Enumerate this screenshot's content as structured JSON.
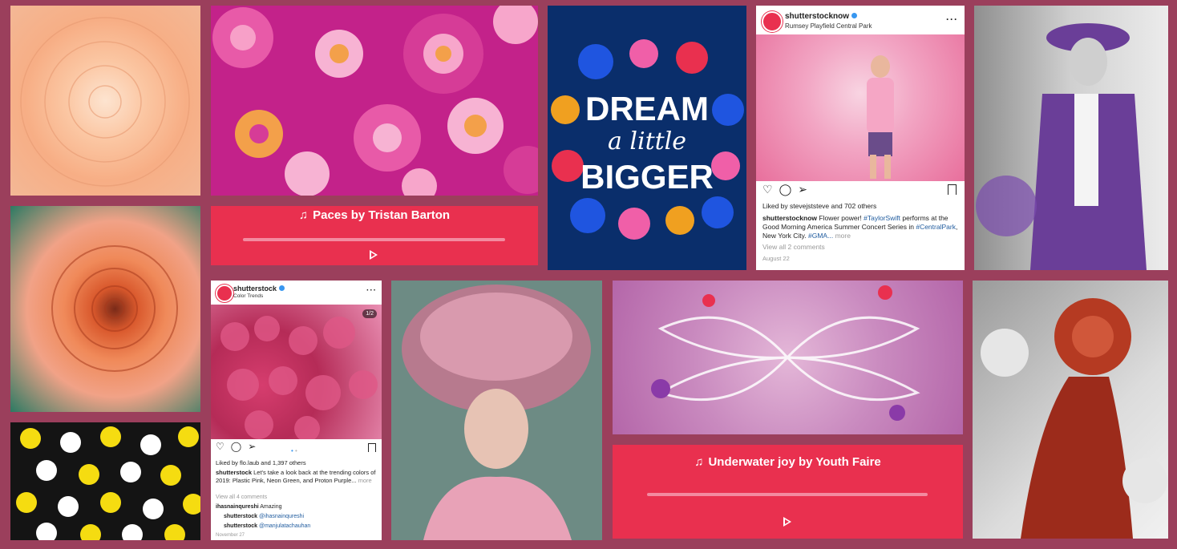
{
  "colors": {
    "background": "#9b3f5c",
    "player": "#e9304f",
    "track": "#f38aa0"
  },
  "players": [
    {
      "title": "Paces by Tristan Barton",
      "icon": "music-note-icon",
      "play_icon": "play-icon"
    },
    {
      "title": "Underwater joy by Youth Faire",
      "icon": "music-note-icon",
      "play_icon": "play-icon"
    }
  ],
  "dream_card": {
    "line1": "DREAM",
    "line2": "a little",
    "line3": "BIGGER"
  },
  "post_taylor": {
    "username": "shutterstocknow",
    "location": "Rumsey Playfield Central Park",
    "liked_by": "Liked by stevejststeve and 702 others",
    "caption_user": "shutterstocknow",
    "caption_1": "Flower power!",
    "caption_tag1": "#TaylorSwift",
    "caption_2": "performs at the Good Morning America Summer Concert Series in",
    "caption_tag2": "#CentralPark",
    "caption_3": ", New York City.",
    "caption_tag3": "#GMA...",
    "more": "more",
    "view_comments": "View all 2 comments",
    "date": "August 22"
  },
  "post_roses": {
    "username": "shutterstock",
    "location": "Color Trends",
    "counter": "1/2",
    "liked_by": "Liked by flo.laub and 1,397 others",
    "caption_user": "shutterstock",
    "caption": "Let's take a look back at the trending colors of 2019: Plastic Pink, Neon Green, and Proton Purple...",
    "more": "more",
    "view_comments": "View all 4 comments",
    "comment1_user": "ihasnainqureshi",
    "comment1": "Amazing",
    "comment2_user": "shutterstock",
    "comment2": "@ihasnainqureshi",
    "comment3_user": "shutterstock",
    "comment3": "@manjulatachauhan",
    "date": "November 27"
  }
}
